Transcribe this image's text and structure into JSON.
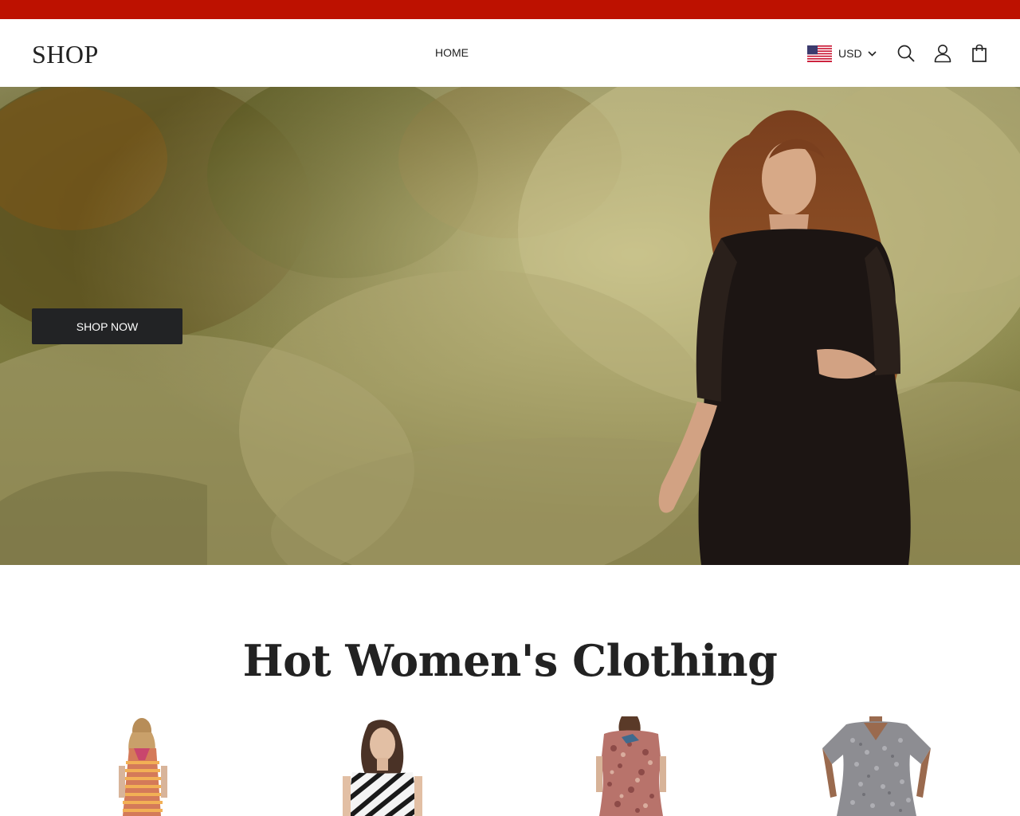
{
  "announcement_bar": {
    "color": "#bd1100"
  },
  "header": {
    "logo": "SHOP",
    "nav": [
      {
        "label": "HOME"
      }
    ],
    "currency": {
      "selected": "USD",
      "flag_icon": "us-flag-icon"
    },
    "icons": [
      "search-icon",
      "account-icon",
      "cart-bag-icon"
    ]
  },
  "hero": {
    "image": "woman-in-black-dress-in-meadow",
    "cta_label": "SHOP NOW"
  },
  "collection": {
    "title": "Hot Women's Clothing",
    "products": [
      {
        "image": "striped-halter-top-back"
      },
      {
        "image": "black-white-striped-dress"
      },
      {
        "image": "floral-print-dress-back"
      },
      {
        "image": "grey-lace-sheath-dress"
      }
    ]
  },
  "colors": {
    "accent": "#bd1100",
    "button": "#222325",
    "text": "#222222"
  }
}
